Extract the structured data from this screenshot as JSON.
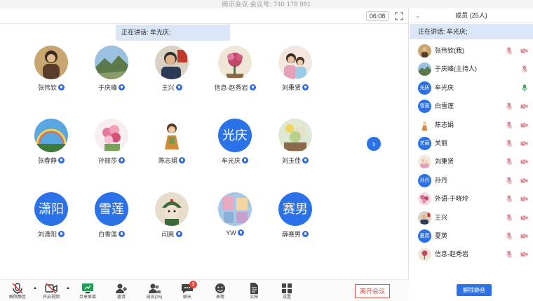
{
  "window": {
    "title": "腾讯会议 会议号: 740 178 981"
  },
  "stage": {
    "timer": "06:08",
    "speaking_banner": "正在讲话: 牟光庆;",
    "participants": [
      {
        "name": "张伟钦",
        "avatar": "photo"
      },
      {
        "name": "于庆峰",
        "avatar": "photo"
      },
      {
        "name": "王兴",
        "avatar": "photo"
      },
      {
        "name": "信息-赵秀岩",
        "avatar": "photo"
      },
      {
        "name": "刘秉贤",
        "avatar": "photo"
      },
      {
        "name": "张春静",
        "avatar": "photo"
      },
      {
        "name": "孙丽莎",
        "avatar": "photo"
      },
      {
        "name": "陈志娟",
        "avatar": "photo"
      },
      {
        "name": "牟光庆",
        "avatar_text": "光庆"
      },
      {
        "name": "刘玉佳",
        "avatar": "photo"
      },
      {
        "name": "刘潇阳",
        "avatar_text": "潇阳"
      },
      {
        "name": "白雪莲",
        "avatar_text": "雪莲"
      },
      {
        "name": "闫爽",
        "avatar": "photo"
      },
      {
        "name": "YW",
        "avatar": "photo"
      },
      {
        "name": "薛赛男",
        "avatar_text": "赛男"
      }
    ]
  },
  "toolbar": {
    "unmute_all": "解除静音",
    "start_video": "开启视频",
    "share_screen": "共享屏幕",
    "invite": "邀请",
    "members": "成员(25)",
    "chat": "聊天",
    "chat_badge": "3",
    "reactions": "表情",
    "docs": "文档",
    "settings": "设置",
    "leave": "离开会议"
  },
  "panel": {
    "title": "成员 (25人)",
    "speaking": "正在讲话: 牟光庆;",
    "members": [
      {
        "name": "张伟钦(我)",
        "avatar": "photo",
        "mic": "muted",
        "cam": "off"
      },
      {
        "name": "于庆峰(主持人)",
        "avatar": "photo",
        "mic": "muted",
        "cam": ""
      },
      {
        "name": "牟光庆",
        "avatar_text": "光庆",
        "mic": "on",
        "cam": ""
      },
      {
        "name": "白雪莲",
        "avatar_text": "雪莲",
        "mic": "muted",
        "cam": "off"
      },
      {
        "name": "陈志娟",
        "avatar": "photo",
        "mic": "muted",
        "cam": "off"
      },
      {
        "name": "关丽",
        "avatar_text": "关丽",
        "mic": "muted",
        "cam": "off"
      },
      {
        "name": "刘秉贤",
        "avatar": "photo",
        "mic": "muted",
        "cam": "off"
      },
      {
        "name": "孙丹",
        "avatar_text": "孙丹",
        "mic": "muted",
        "cam": "off"
      },
      {
        "name": "外语-于晓玲",
        "avatar": "photo",
        "mic": "muted",
        "cam": "off"
      },
      {
        "name": "王兴",
        "avatar": "photo",
        "mic": "muted",
        "cam": "off"
      },
      {
        "name": "夏英",
        "avatar_text": "夏英",
        "mic": "muted",
        "cam": "off"
      },
      {
        "name": "信息-赵秀岩",
        "avatar": "photo",
        "mic": "muted",
        "cam": "off"
      }
    ],
    "unmute_button": "解除静音"
  },
  "colors": {
    "accent": "#2b71e8",
    "banner": "#dbe7f9",
    "danger": "#e0463d",
    "muted_icon": "#d98a94"
  }
}
